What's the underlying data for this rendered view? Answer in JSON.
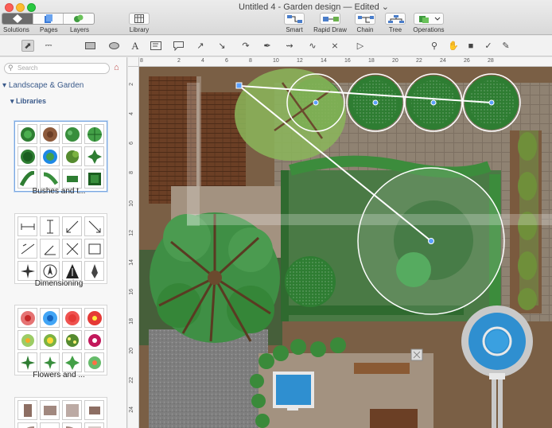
{
  "window": {
    "title": "Untitled 4 - Garden design — Edited"
  },
  "segmented": [
    {
      "label": "Solutions",
      "icon": "solutions-icon"
    },
    {
      "label": "Pages",
      "icon": "pages-icon"
    },
    {
      "label": "Layers",
      "icon": "layers-icon"
    }
  ],
  "library_button": {
    "label": "Library"
  },
  "right_tools": [
    {
      "label": "Smart"
    },
    {
      "label": "Rapid Draw"
    },
    {
      "label": "Chain"
    },
    {
      "label": "Tree"
    },
    {
      "label": "Operations"
    }
  ],
  "search": {
    "placeholder": "Search"
  },
  "tree": {
    "root": "Landscape & Garden",
    "child": "Libraries"
  },
  "libraries": [
    {
      "name": "Bushes and t..."
    },
    {
      "name": "Dimensioning"
    },
    {
      "name": "Flowers and ..."
    }
  ],
  "ruler": {
    "top": [
      "8",
      "2",
      "4",
      "6",
      "8",
      "10",
      "12",
      "14",
      "16",
      "18",
      "20",
      "22",
      "24",
      "26",
      "28"
    ],
    "left": [
      "2",
      "4",
      "6",
      "8",
      "10",
      "12",
      "14",
      "16",
      "18",
      "20",
      "22",
      "24"
    ]
  },
  "colors": {
    "lawn": "#4a7a45",
    "soil": "#7a5a3e",
    "stone": "#8f8070",
    "deck": "#6b3f25",
    "water": "#2f8fd0",
    "shrub": "#3a8a3a",
    "path": "#a39280"
  }
}
